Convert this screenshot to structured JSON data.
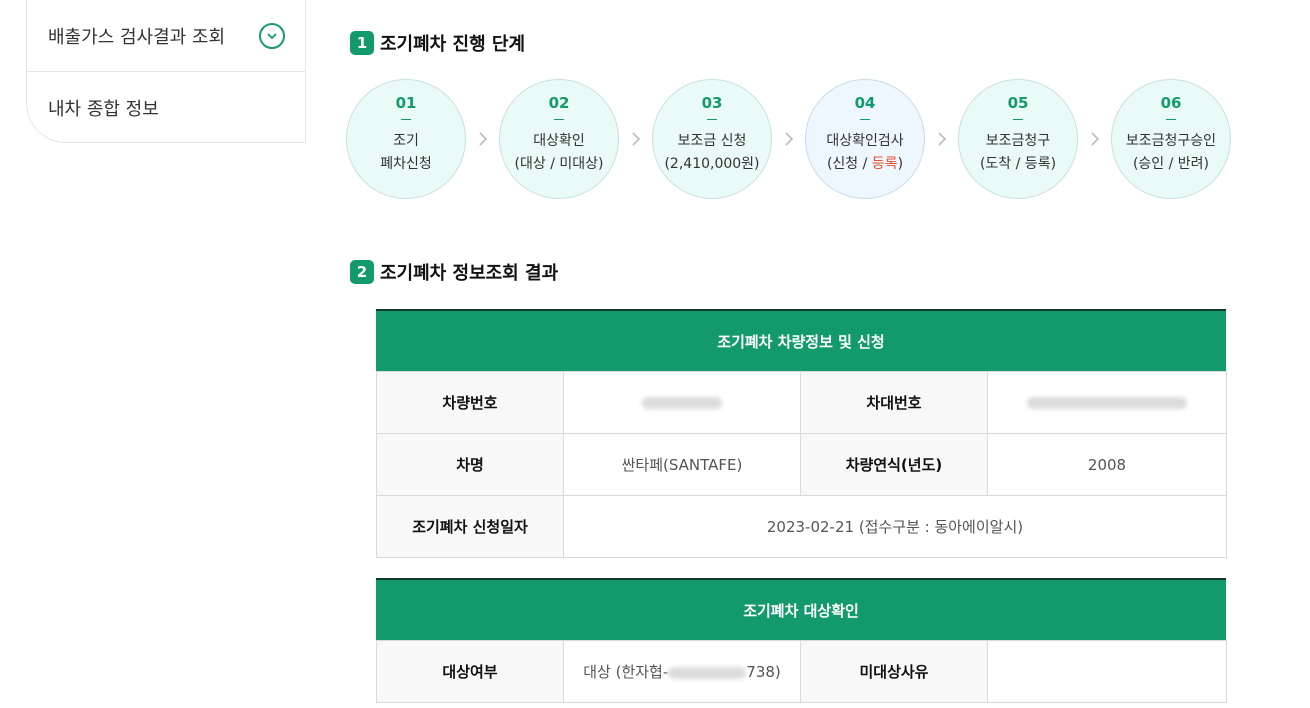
{
  "sidebar": {
    "items": [
      {
        "label": "배출가스 검사결과 조회"
      },
      {
        "label": "내차 종합 정보"
      }
    ]
  },
  "section1": {
    "num": "1",
    "title": "조기폐차 진행 단계"
  },
  "steps": [
    {
      "num": "01",
      "line1": "조기",
      "line2": "폐차신청"
    },
    {
      "num": "02",
      "line1": "대상확인",
      "line2": "(대상 / 미대상)"
    },
    {
      "num": "03",
      "line1": "보조금 신청",
      "line2": "(2,410,000원)"
    },
    {
      "num": "04",
      "line1": "대상확인검사",
      "line2_pre": "(신청 / ",
      "line2_red": "등록",
      "line2_post": ")"
    },
    {
      "num": "05",
      "line1": "보조금청구",
      "line2": "(도착 / 등록)"
    },
    {
      "num": "06",
      "line1": "보조금청구승인",
      "line2": "(승인 / 반려)"
    }
  ],
  "section2": {
    "num": "2",
    "title": "조기폐차 정보조회 결과"
  },
  "vehicle_table": {
    "header": "조기폐차 차량정보 및 신청",
    "plate_label": "차량번호",
    "vin_label": "차대번호",
    "model_label": "차명",
    "model_value": "싼타페(SANTAFE)",
    "year_label": "차량연식(년도)",
    "year_value": "2008",
    "date_label": "조기폐차 신청일자",
    "date_value": "2023-02-21 (접수구분 : 동아에이알시)"
  },
  "target_table": {
    "header": "조기폐차 대상확인",
    "status_label": "대상여부",
    "status_value_pre": "대상 (한자협-",
    "status_value_post": "738)",
    "reason_label": "미대상사유",
    "reason_value": ""
  },
  "colors": {
    "brand": "#129a6c",
    "accent_red": "#e2502c"
  }
}
